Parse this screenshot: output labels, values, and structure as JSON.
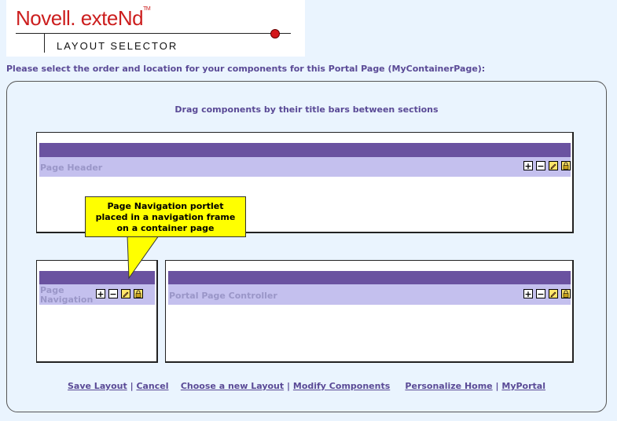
{
  "logo": {
    "brand": "Novell. exteNd",
    "trademark": "TM",
    "subtitle": "LAYOUT SELECTOR"
  },
  "instruction": "Please select the order and location for your components for this Portal Page (MyContainerPage):",
  "drag_hint": "Drag components by their title bars between sections",
  "sections": {
    "header": {
      "portlet_title": "Page Header"
    },
    "navigation": {
      "portlet_title": "Page Navigation"
    },
    "main": {
      "portlet_title": "Portal Page Controller"
    }
  },
  "portlet_buttons": {
    "add": "+",
    "minimize": "−"
  },
  "callout": {
    "line1": "Page Navigation portlet",
    "line2": "placed in a navigation frame",
    "line3": "on a container page"
  },
  "footer": {
    "save_layout": "Save Layout",
    "cancel": "Cancel",
    "choose_layout": "Choose a new Layout",
    "modify_components": "Modify Components",
    "personalize_home": "Personalize Home",
    "my_portal": "MyPortal",
    "separator": "|"
  },
  "colors": {
    "brand_red": "#cc1e1e",
    "title_bar_purple": "#6a52a0",
    "portlet_bar_lavender": "#c4c0ee",
    "text_purple": "#5a4a96",
    "callout_yellow": "#ffff00",
    "background": "#eaf4fe"
  }
}
